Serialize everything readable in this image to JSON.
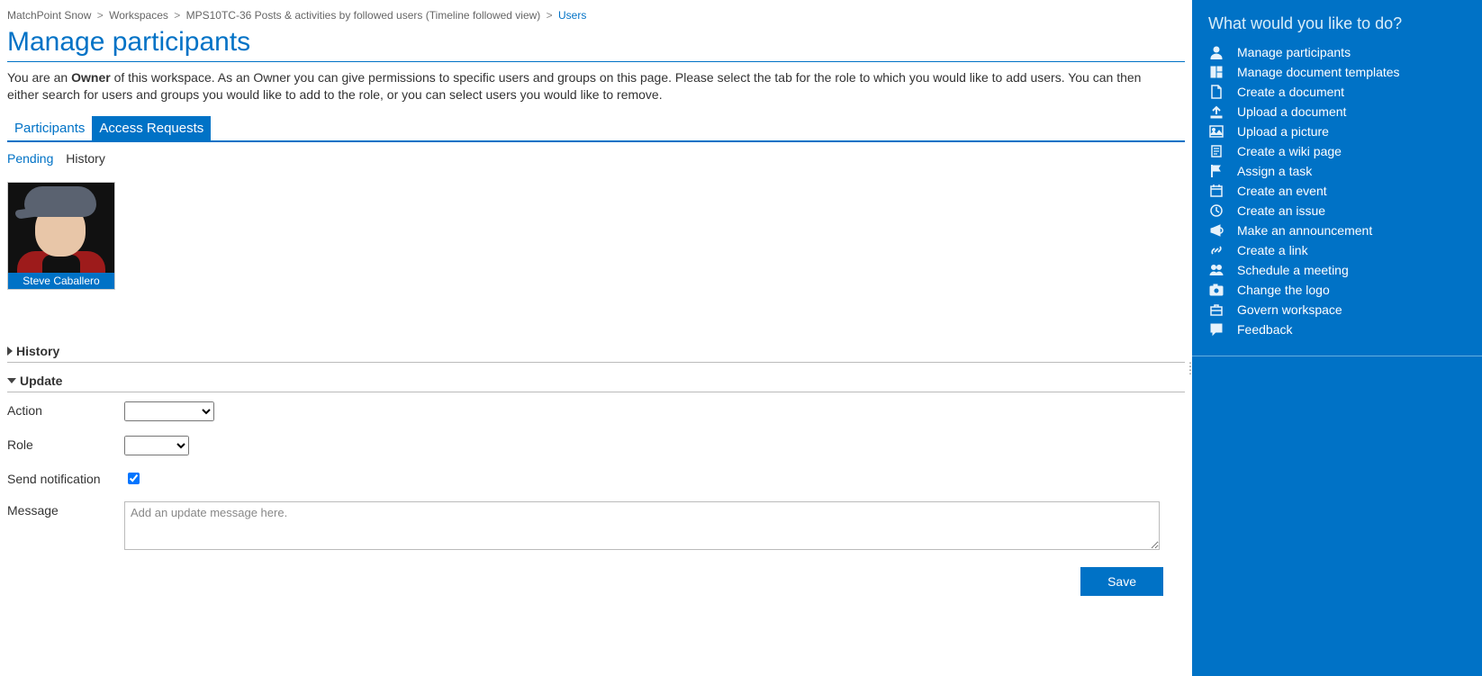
{
  "breadcrumb": {
    "root": "MatchPoint Snow",
    "workspaces": "Workspaces",
    "item": "MPS10TC-36 Posts & activities by followed users (Timeline followed view)",
    "current": "Users"
  },
  "page_title": "Manage participants",
  "intro": {
    "prefix": "You are an ",
    "role": "Owner",
    "rest": " of this workspace. As an Owner you can give permissions to specific users and groups on this page. Please select the tab for the role to which you would like to add users. You can then either search for users and groups you would like to add to the role, or you can select users you would like to remove."
  },
  "tabs": {
    "participants": "Participants",
    "access_requests": "Access Requests"
  },
  "subtabs": {
    "pending": "Pending",
    "history": "History"
  },
  "user_card": {
    "name": "Steve Caballero"
  },
  "sections": {
    "history": "History",
    "update": "Update"
  },
  "form": {
    "action_label": "Action",
    "role_label": "Role",
    "send_notification_label": "Send notification",
    "send_notification_checked": true,
    "message_label": "Message",
    "message_placeholder": "Add an update message here.",
    "save_label": "Save"
  },
  "sidebar": {
    "title": "What would you like to do?",
    "items": [
      {
        "icon": "user-icon",
        "label": "Manage participants"
      },
      {
        "icon": "templates-icon",
        "label": "Manage document templates"
      },
      {
        "icon": "document-icon",
        "label": "Create a document"
      },
      {
        "icon": "upload-icon",
        "label": "Upload a document"
      },
      {
        "icon": "picture-icon",
        "label": "Upload a picture"
      },
      {
        "icon": "wiki-icon",
        "label": "Create a wiki page"
      },
      {
        "icon": "flag-icon",
        "label": "Assign a task"
      },
      {
        "icon": "calendar-icon",
        "label": "Create an event"
      },
      {
        "icon": "clock-icon",
        "label": "Create an issue"
      },
      {
        "icon": "megaphone-icon",
        "label": "Make an announcement"
      },
      {
        "icon": "link-icon",
        "label": "Create a link"
      },
      {
        "icon": "people-icon",
        "label": "Schedule a meeting"
      },
      {
        "icon": "camera-icon",
        "label": "Change the logo"
      },
      {
        "icon": "briefcase-icon",
        "label": "Govern workspace"
      },
      {
        "icon": "comment-icon",
        "label": "Feedback"
      }
    ]
  }
}
